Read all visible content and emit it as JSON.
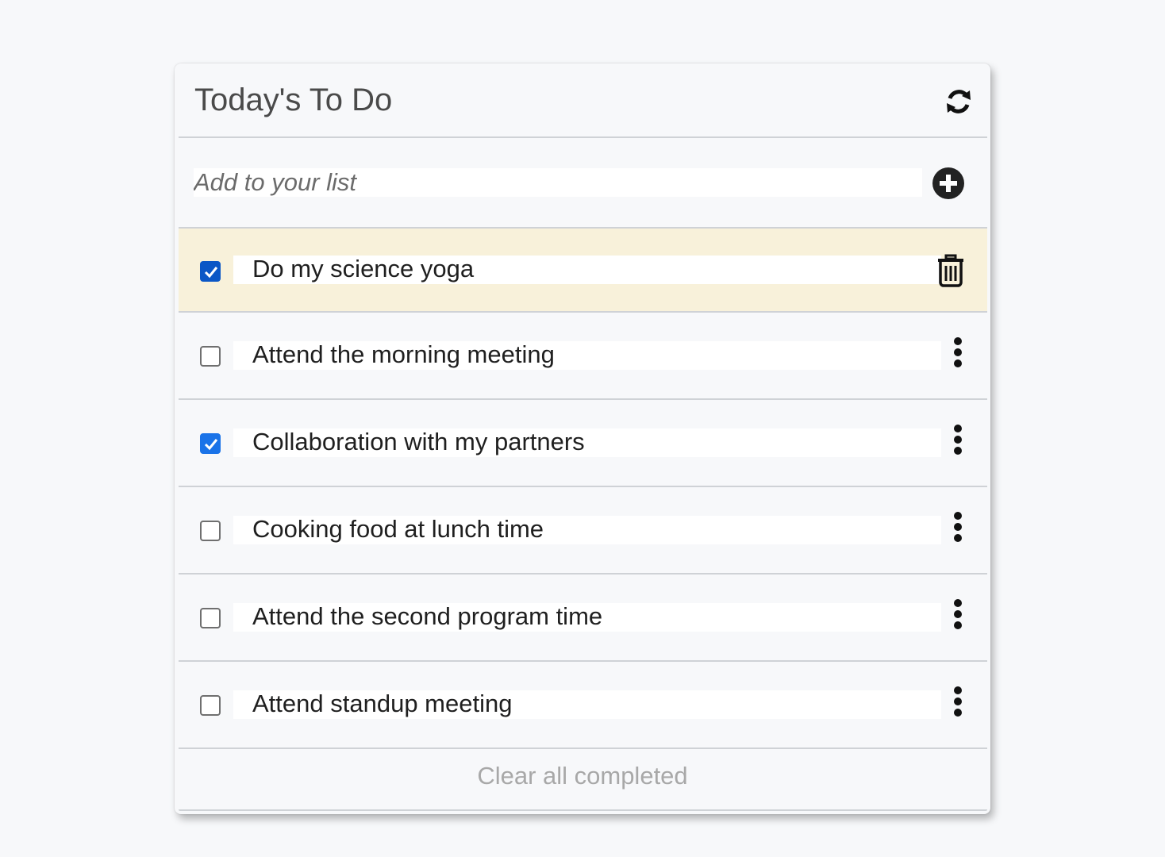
{
  "header": {
    "title": "Today's To Do",
    "refresh_icon": "refresh-icon"
  },
  "add": {
    "placeholder": "Add to your list",
    "value": "",
    "add_icon": "plus-circle-icon"
  },
  "items": [
    {
      "label": "Do my science yoga",
      "checked": true,
      "highlighted": true,
      "action_icon": "trash-icon"
    },
    {
      "label": "Attend the morning meeting",
      "checked": false,
      "highlighted": false,
      "action_icon": "more-vertical-icon"
    },
    {
      "label": "Collaboration with my partners",
      "checked": true,
      "highlighted": false,
      "action_icon": "more-vertical-icon"
    },
    {
      "label": "Cooking food at lunch time",
      "checked": false,
      "highlighted": false,
      "action_icon": "more-vertical-icon"
    },
    {
      "label": "Attend the second program time",
      "checked": false,
      "highlighted": false,
      "action_icon": "more-vertical-icon"
    },
    {
      "label": "Attend standup meeting",
      "checked": false,
      "highlighted": false,
      "action_icon": "more-vertical-icon"
    }
  ],
  "footer": {
    "clear_label": "Clear all completed"
  },
  "colors": {
    "highlight_row": "#f8f1da",
    "checkbox_checked": "#1a73e8",
    "clear_text": "#a8a8a8",
    "title_text": "#4a4a4a"
  }
}
